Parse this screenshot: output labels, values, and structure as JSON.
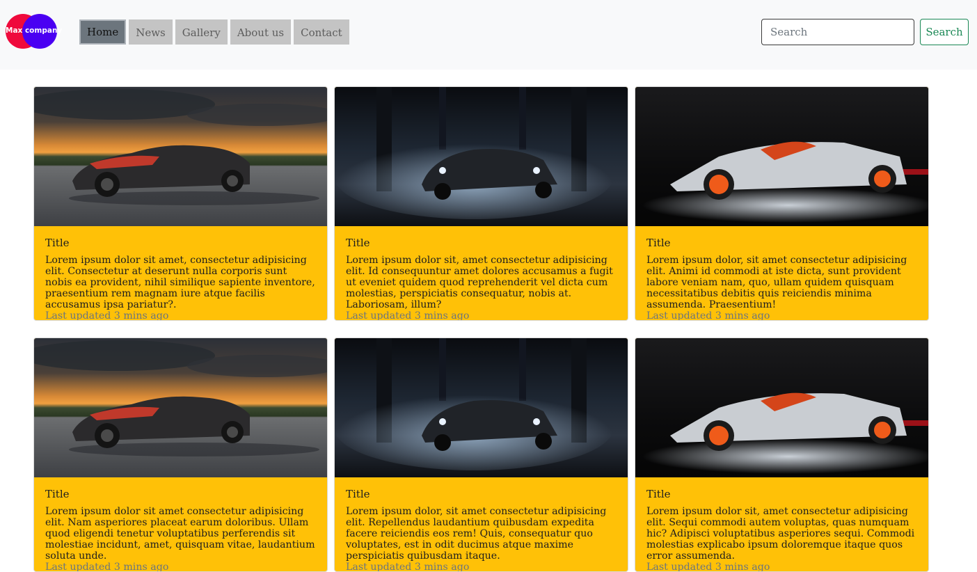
{
  "brand": {
    "logo_text": "Max company"
  },
  "nav": {
    "items": [
      {
        "label": "Home",
        "active": true
      },
      {
        "label": "News"
      },
      {
        "label": "Gallery"
      },
      {
        "label": "About us"
      },
      {
        "label": "Contact"
      }
    ]
  },
  "search": {
    "placeholder": "Search",
    "value": "",
    "button_label": "Search"
  },
  "colors": {
    "card_background": "#ffc107",
    "search_button": "#198754",
    "navbar_background": "#f8f9fa"
  },
  "cards": [
    {
      "image": "bugatti-sunset-photo",
      "title": "Title",
      "text": "Lorem ipsum dolor sit amet, consectetur adipisicing elit. Consectetur at deserunt nulla corporis sunt nobis ea provident, nihil similique sapiente inventore, praesentium rem magnam iure atque facilis accusamus ipsa pariatur?.",
      "updated": "Last updated 3 mins ago"
    },
    {
      "image": "mercedes-garage-smoke-photo",
      "title": "Title",
      "text": "Lorem ipsum dolor sit, amet consectetur adipisicing elit. Id consequuntur amet dolores accusamus a fugit ut eveniet quidem quod reprehenderit vel dicta cum molestias, perspiciatis consequatur, nobis at. Laboriosam, illum?",
      "updated": "Last updated 3 mins ago"
    },
    {
      "image": "lamborghini-egoista-photo",
      "title": "Title",
      "text": "Lorem ipsum dolor, sit amet consectetur adipisicing elit. Animi id commodi at iste dicta, sunt provident labore veniam nam, quo, ullam quidem quisquam necessitatibus debitis quis reiciendis minima assumenda. Praesentium!",
      "updated": "Last updated 3 mins ago"
    },
    {
      "image": "bugatti-sunset-photo",
      "title": "Title",
      "text": "Lorem ipsum dolor sit amet consectetur adipisicing elit. Nam asperiores placeat earum doloribus. Ullam quod eligendi tenetur voluptatibus perferendis sit molestiae incidunt, amet, quisquam vitae, laudantium soluta unde.",
      "updated": "Last updated 3 mins ago"
    },
    {
      "image": "mercedes-garage-smoke-photo",
      "title": "Title",
      "text": "Lorem ipsum dolor, sit amet consectetur adipisicing elit. Repellendus laudantium quibusdam expedita facere reiciendis eos rem! Quis, consequatur quo voluptates, est in odit ducimus atque maxime perspiciatis quibusdam itaque.",
      "updated": "Last updated 3 mins ago"
    },
    {
      "image": "lamborghini-egoista-photo",
      "title": "Title",
      "text": "Lorem ipsum dolor sit, amet consectetur adipisicing elit. Sequi commodi autem voluptas, quas numquam hic? Adipisci voluptatibus asperiores sequi. Commodi molestias explicabo ipsum doloremque itaque quos error assumenda.",
      "updated": "Last updated 3 mins ago"
    }
  ]
}
